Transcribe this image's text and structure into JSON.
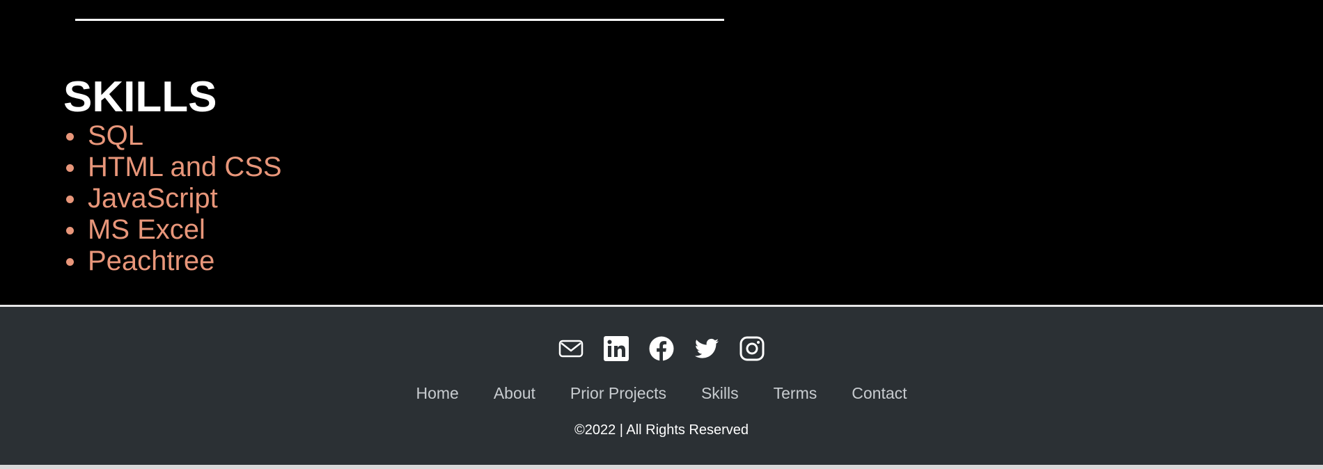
{
  "skills": {
    "title": "SKILLS",
    "items": [
      "SQL",
      "HTML and CSS",
      "JavaScript",
      "MS Excel",
      "Peachtree"
    ]
  },
  "footer": {
    "social": [
      {
        "icon": "envelope-icon"
      },
      {
        "icon": "linkedin-icon"
      },
      {
        "icon": "facebook-icon"
      },
      {
        "icon": "twitter-icon"
      },
      {
        "icon": "instagram-icon"
      }
    ],
    "nav": [
      "Home",
      "About",
      "Prior Projects",
      "Skills",
      "Terms",
      "Contact"
    ],
    "copyright": "©2022 | All Rights Reserved"
  },
  "colors": {
    "background": "#000000",
    "accent": "#e8967a",
    "footer_bg": "#2b3034",
    "footer_link": "#c8ccd0",
    "text": "#ffffff"
  }
}
